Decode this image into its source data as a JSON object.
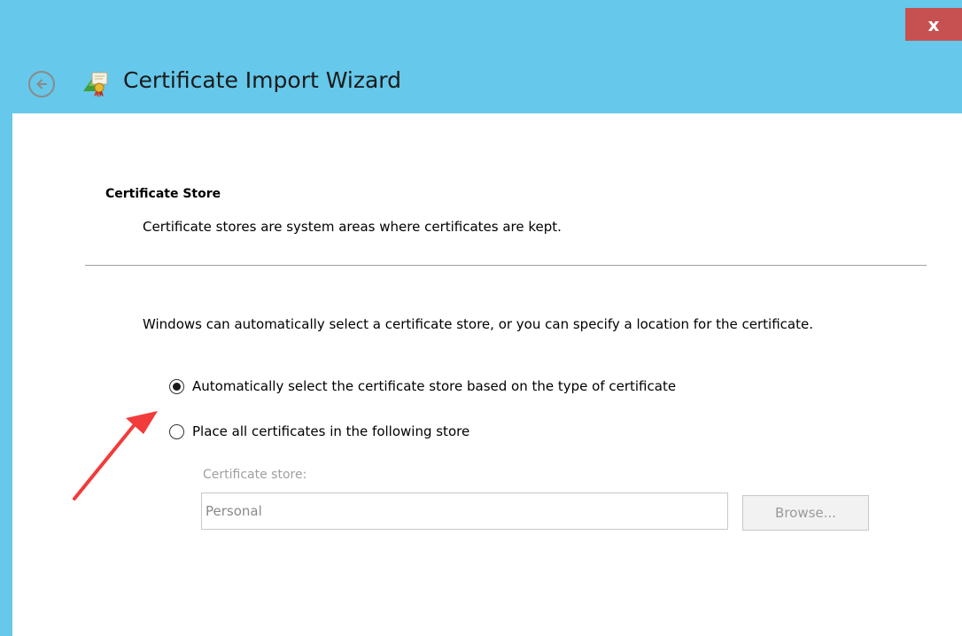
{
  "window": {
    "title": "Certificate Import Wizard",
    "close_label": "x",
    "accent_color": "#66c8ea",
    "close_color": "#c75050"
  },
  "icons": {
    "back": "back-arrow-icon",
    "wizard": "certificate-wizard-icon",
    "annotation": "red-arrow-annotation"
  },
  "section": {
    "heading": "Certificate Store",
    "description": "Certificate stores are system areas where certificates are kept."
  },
  "body": {
    "intro": "Windows can automatically select a certificate store, or you can specify a location for the certificate."
  },
  "options": [
    {
      "label": "Automatically select the certificate store based on the type of certificate",
      "selected": true
    },
    {
      "label": "Place all certificates in the following store",
      "selected": false
    }
  ],
  "store": {
    "label": "Certificate store:",
    "value": "Personal",
    "browse_label": "Browse...",
    "enabled": false
  }
}
